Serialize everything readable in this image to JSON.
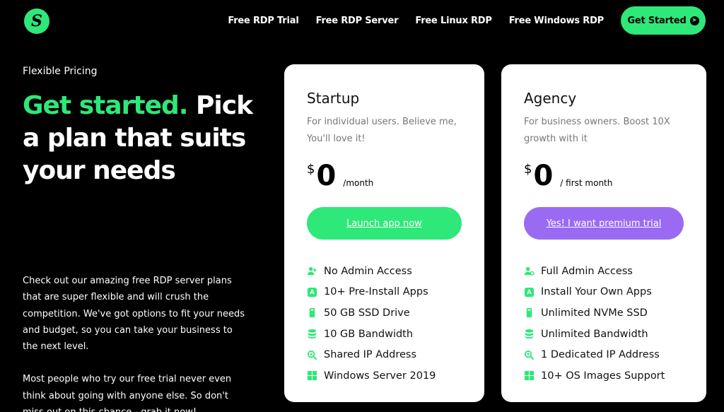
{
  "brand": {
    "logo_letter": "S",
    "accent": "#2ee879",
    "purple": "#9a6bf2"
  },
  "nav": {
    "items": [
      {
        "label": "Free RDP Trial"
      },
      {
        "label": "Free RDP Server"
      },
      {
        "label": "Free Linux RDP"
      },
      {
        "label": "Free Windows RDP"
      }
    ],
    "cta_label": "Get Started"
  },
  "hero": {
    "eyebrow": "Flexible Pricing",
    "headline_accent": "Get started.",
    "headline_rest": " Pick a plan that suits your needs",
    "paragraphs": [
      "Check out our amazing free RDP server plans that are super flexible and will crush the competition. We've got options to fit your needs and budget, so you can take your business to the next level.",
      "Most people who try our free trial never even think about going with anyone else. So don't miss out on this chance - grab it now!"
    ]
  },
  "plans": [
    {
      "name": "Startup",
      "subtitle": "For individual users. Believe me, You'll love it!",
      "currency": "$",
      "price": "0",
      "period": "/month",
      "button": "Launch app now",
      "features": [
        {
          "icon": "user-plus-icon",
          "text": "No Admin Access"
        },
        {
          "icon": "app-store-icon",
          "text": "10+ Pre-Install Apps"
        },
        {
          "icon": "ssd-drive-icon",
          "text": "50 GB SSD Drive"
        },
        {
          "icon": "database-icon",
          "text": "10 GB Bandwidth"
        },
        {
          "icon": "ip-search-icon",
          "text": "Shared IP Address"
        },
        {
          "icon": "windows-icon",
          "text": "Windows Server 2019"
        }
      ]
    },
    {
      "name": "Agency",
      "subtitle": "For business owners. Boost 10X growth with it",
      "currency": "$",
      "price": "0",
      "period": "/ first month",
      "button": "Yes! I want premium trial",
      "features": [
        {
          "icon": "user-admin-icon",
          "text": "Full Admin Access"
        },
        {
          "icon": "app-store-icon",
          "text": "Install Your Own Apps"
        },
        {
          "icon": "ssd-drive-icon",
          "text": "Unlimited NVMe SSD"
        },
        {
          "icon": "database-icon",
          "text": "Unlimited Bandwidth"
        },
        {
          "icon": "ip-search-icon",
          "text": "1 Dedicated IP Address"
        },
        {
          "icon": "windows-icon",
          "text": "10+ OS Images Support"
        }
      ]
    }
  ]
}
